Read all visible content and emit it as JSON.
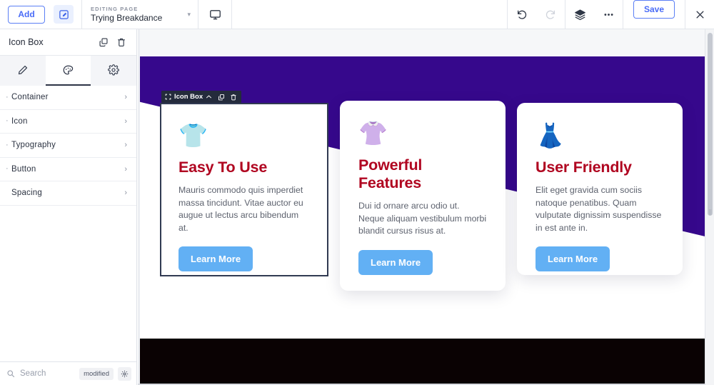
{
  "topbar": {
    "add_label": "Add",
    "edit_icon": "edit-square-icon",
    "page_kicker": "EDITING PAGE",
    "page_name": "Trying Breakdance",
    "page_caret": "▾",
    "device_icon": "desktop-monitor-icon",
    "undo_icon": "undo-arrow-icon",
    "redo_icon": "redo-arrow-icon",
    "layers_icon": "layers-stack-icon",
    "more_icon": "more-ellipsis-icon",
    "save_label": "Save",
    "close_icon": "close-x-icon"
  },
  "sidebar": {
    "title": "Icon Box",
    "duplicate_icon": "duplicate-copy-icon",
    "delete_icon": "trash-bin-icon",
    "tabs": [
      {
        "name": "content",
        "icon": "pencil-icon",
        "active": false
      },
      {
        "name": "style",
        "icon": "palette-icon",
        "active": true
      },
      {
        "name": "settings",
        "icon": "gear-icon",
        "active": false
      }
    ],
    "rows": [
      {
        "label": "Container",
        "dot": "·",
        "chevron": "›"
      },
      {
        "label": "Icon",
        "dot": "·",
        "chevron": "›"
      },
      {
        "label": "Typography",
        "dot": "·",
        "chevron": "›"
      },
      {
        "label": "Button",
        "dot": "·",
        "chevron": "›"
      },
      {
        "label": "Spacing",
        "dot": "",
        "chevron": "›"
      }
    ],
    "footer": {
      "search_icon": "search-magnifier-icon",
      "search_placeholder": "Search",
      "badge": "modified",
      "gear_icon": "gear-icon"
    }
  },
  "canvas": {
    "element_toolbar": {
      "drag_icon": "move-drag-icon",
      "label": "Icon Box",
      "collapse_icon": "chevron-up-icon",
      "duplicate_icon": "duplicate-copy-icon",
      "delete_icon": "trash-bin-icon"
    },
    "background_purple": "#36088c",
    "footer_band_color": "#0a0203",
    "heading_color": "#b00520",
    "button_color": "#62b0f4",
    "cards": [
      {
        "emoji": "👕",
        "emoji_name": "baby-bodysuit-icon",
        "title": "Easy To Use",
        "body": "Mauris commodo quis imperdiet massa tincidunt. Vitae auctor eu augue ut lectus arcu bibendum at.",
        "button": "Learn More",
        "selected": true
      },
      {
        "emoji": "👚",
        "emoji_name": "red-overalls-icon",
        "title": "Powerful Features",
        "body": "Dui id ornare arcu odio ut. Neque aliquam vestibulum morbi blandit cursus risus at.",
        "button": "Learn More",
        "selected": false
      },
      {
        "emoji": "👗",
        "emoji_name": "yellow-dress-icon",
        "title": "User Friendly",
        "body": "Elit eget gravida cum sociis natoque penatibus. Quam vulputate dignissim suspendisse in est ante in.",
        "button": "Learn More",
        "selected": false
      }
    ]
  },
  "scrollbar": {
    "grip": "⣿"
  }
}
